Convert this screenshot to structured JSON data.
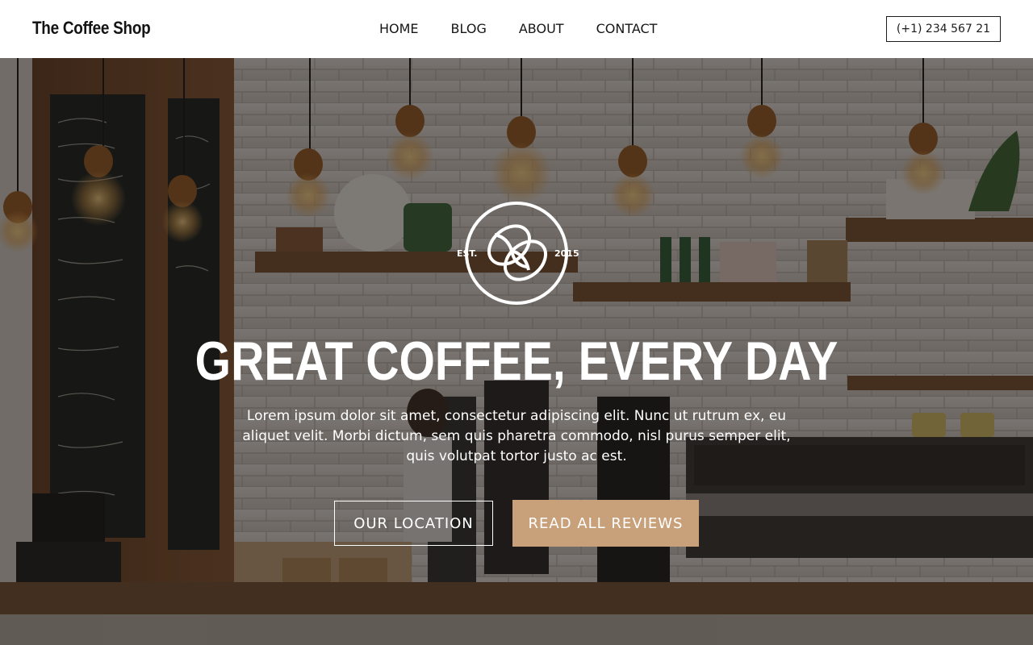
{
  "header": {
    "brand": "The Coffee Shop",
    "nav": [
      "HOME",
      "BLOG",
      "ABOUT",
      "CONTACT"
    ],
    "phone": "(+1) 234 567 21"
  },
  "hero": {
    "badge_left": "EST.",
    "badge_right": "2015",
    "badge_icon": "coffee-beans-icon",
    "headline": "GREAT COFFEE, EVERY DAY",
    "subtext": "Lorem ipsum dolor sit amet, consectetur adipiscing elit. Nunc ut rutrum ex, eu aliquet velit. Morbi dictum, sem quis pharetra commodo, nisl purus semper elit, quis volutpat tortor justo ac est.",
    "primary_button": "OUR LOCATION",
    "secondary_button": "READ ALL REVIEWS"
  },
  "colors": {
    "accent": "#c8a07a",
    "header_bg": "#ffffff",
    "text_dark": "#161616"
  }
}
